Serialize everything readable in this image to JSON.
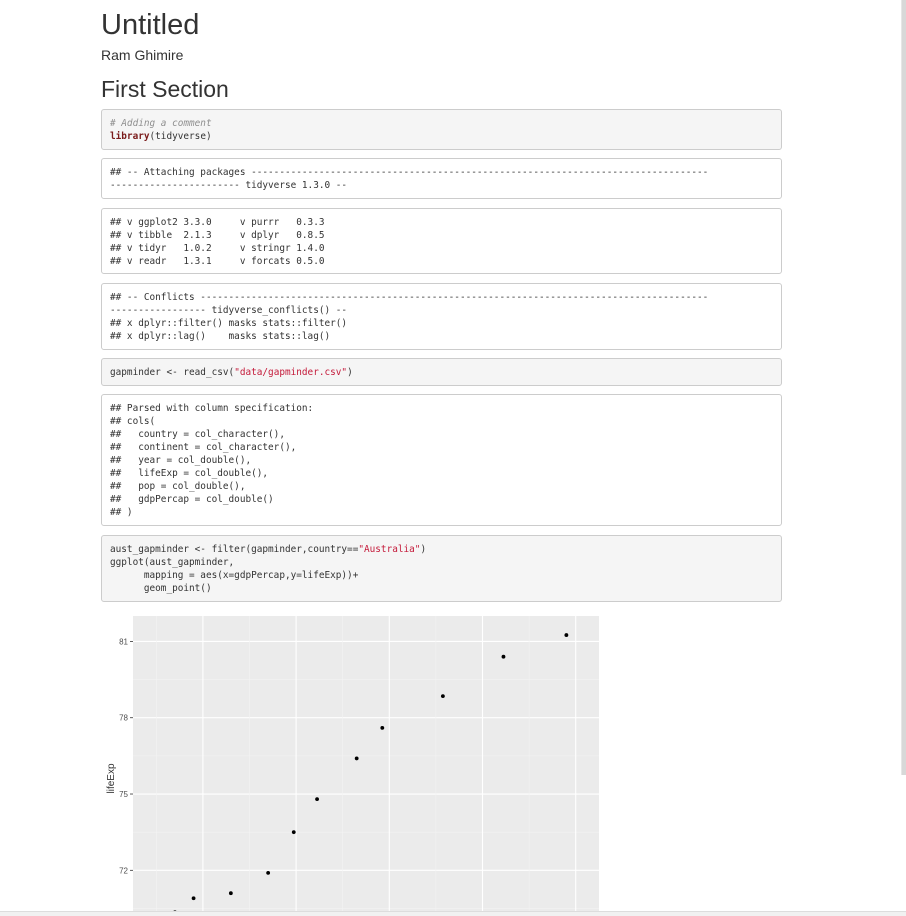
{
  "document": {
    "title": "Untitled",
    "author": "Ram Ghimire",
    "section_title": "First Section"
  },
  "blocks": {
    "b1": {
      "comment": "# Adding a comment",
      "keyword": "library",
      "rest": "(tidyverse)"
    },
    "b2": [
      "## -- Attaching packages ---------------------------------------------------------------------------------",
      "----------------------- tidyverse 1.3.0 --"
    ],
    "b3": [
      "## v ggplot2 3.3.0     v purrr   0.3.3",
      "## v tibble  2.1.3     v dplyr   0.8.5",
      "## v tidyr   1.0.2     v stringr 1.4.0",
      "## v readr   1.3.1     v forcats 0.5.0"
    ],
    "b4": [
      "## -- Conflicts ------------------------------------------------------------------------------------------",
      "----------------- tidyverse_conflicts() --",
      "## x dplyr::filter() masks stats::filter()",
      "## x dplyr::lag()    masks stats::lag()"
    ],
    "b5": {
      "pre": "gapminder <- read_csv(",
      "str": "\"data/gapminder.csv\"",
      "post": ")"
    },
    "b6": [
      "## Parsed with column specification:",
      "## cols(",
      "##   country = col_character(),",
      "##   continent = col_character(),",
      "##   year = col_double(),",
      "##   lifeExp = col_double(),",
      "##   pop = col_double(),",
      "##   gdpPercap = col_double()",
      "## )"
    ],
    "b7": {
      "l1_pre": "aust_gapminder <- filter(gapminder,country==",
      "l1_str": "\"Australia\"",
      "l1_post": ")",
      "l2": "ggplot(aust_gapminder,",
      "l3": "      mapping = aes(x=gdpPercap,y=lifeExp))+",
      "l4": "      geom_point()"
    }
  },
  "chart_data": {
    "type": "scatter",
    "ylabel": "lifeExp",
    "xlabel": "",
    "yticks": [
      72,
      75,
      78,
      81
    ],
    "ylim": [
      70.4,
      82.0
    ],
    "xlim": [
      0,
      1
    ],
    "grid": true,
    "x": [
      0.09,
      0.13,
      0.21,
      0.29,
      0.345,
      0.395,
      0.48,
      0.535,
      0.665,
      0.795,
      0.93
    ],
    "y": [
      70.35,
      70.9,
      71.1,
      71.9,
      73.5,
      74.8,
      76.4,
      77.6,
      78.85,
      80.4,
      81.25
    ],
    "colors": {
      "panel": "#ebebeb",
      "grid_major": "#ffffff",
      "grid_minor": "#f3f3f3",
      "point": "#000000"
    }
  }
}
